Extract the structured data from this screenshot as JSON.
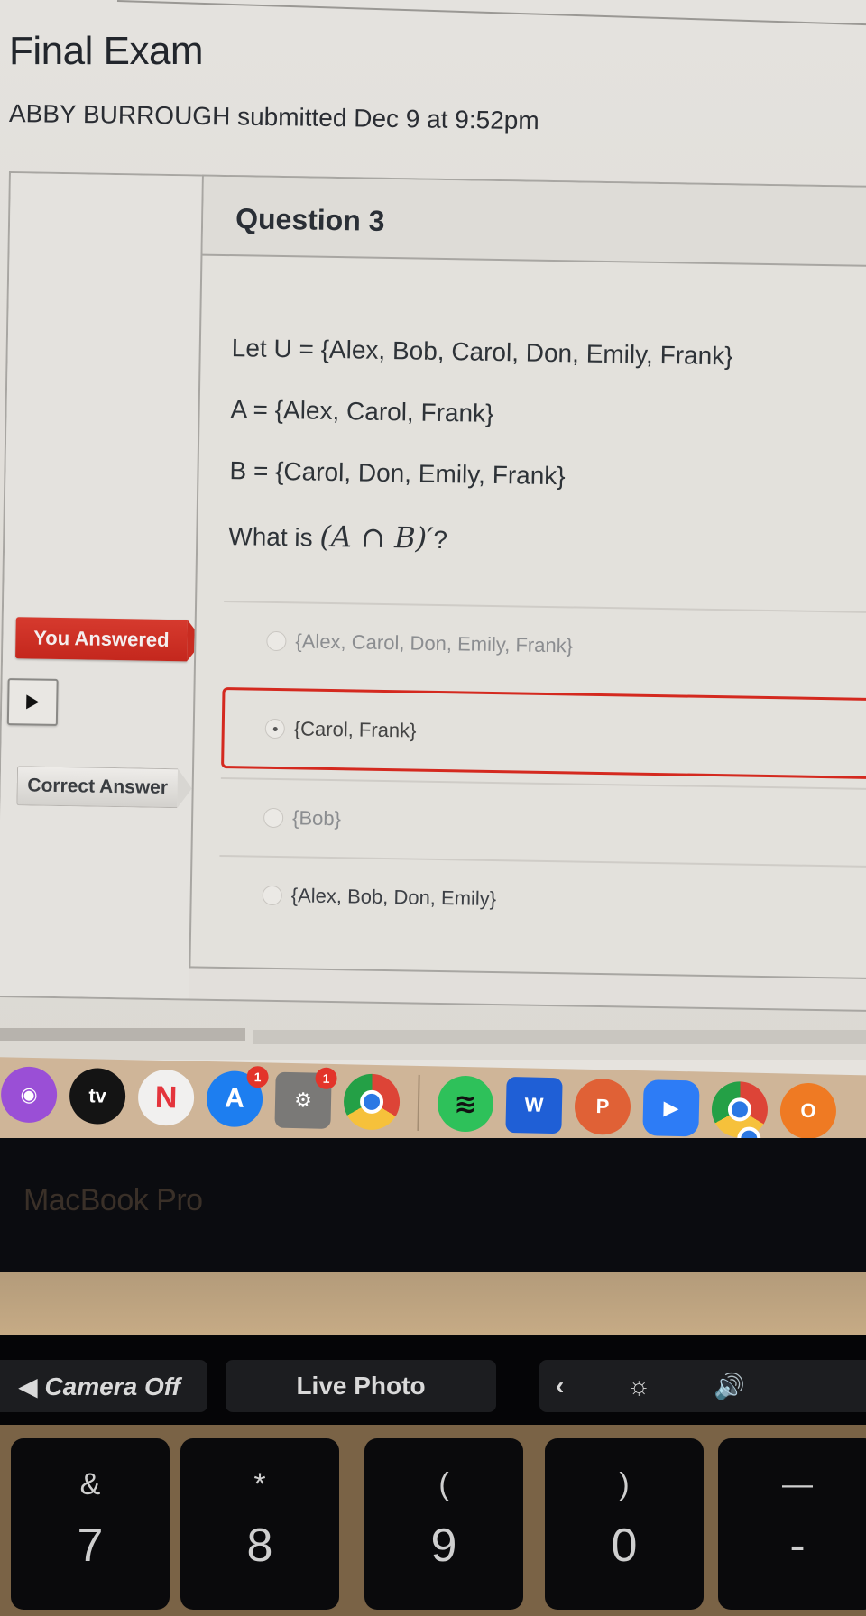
{
  "page": {
    "title": "Final Exam",
    "submitted": "ABBY BURROUGH submitted Dec 9 at 9:52pm"
  },
  "question": {
    "header": "Question 3",
    "lines": [
      "Let U = {Alex, Bob, Carol, Don, Emily, Frank}",
      "A = {Alex, Carol, Frank}",
      "B = {Carol, Don, Emily, Frank}"
    ],
    "prompt_prefix": "What is ",
    "prompt_math": "(A ∩ B)′",
    "prompt_suffix": "?",
    "answers": [
      {
        "label": "{Alex, Carol, Don, Emily, Frank}",
        "selected": false,
        "correct": false
      },
      {
        "label": "{Carol, Frank}",
        "selected": true,
        "correct": false
      },
      {
        "label": "{Bob}",
        "selected": false,
        "correct": false
      },
      {
        "label": "{Alex, Bob, Don, Emily}",
        "selected": false,
        "correct": true
      }
    ],
    "you_answered_label": "You Answered",
    "correct_answer_label": "Correct Answer"
  },
  "dock": {
    "apps": [
      {
        "name": "Podcasts",
        "glyph": "◉"
      },
      {
        "name": "Apple TV",
        "glyph": "tv"
      },
      {
        "name": "News",
        "glyph": "N"
      },
      {
        "name": "App Store",
        "glyph": "A",
        "badge": "1"
      },
      {
        "name": "System Preferences",
        "glyph": "⚙",
        "badge": "1"
      },
      {
        "name": "Chrome",
        "glyph": ""
      },
      {
        "name": "Spotify",
        "glyph": "≋"
      },
      {
        "name": "Word",
        "glyph": "W"
      },
      {
        "name": "PowerPoint",
        "glyph": "P"
      },
      {
        "name": "Zoom",
        "glyph": "▶"
      },
      {
        "name": "Chrome",
        "glyph": ""
      },
      {
        "name": "Origin",
        "glyph": "O"
      }
    ]
  },
  "bezel": {
    "label": "MacBook Pro"
  },
  "touchbar": {
    "camera": "◀ Camera Off",
    "live_photo": "Live Photo",
    "collapse": "‹",
    "brightness": "☼",
    "volume": "🔊"
  },
  "keys": [
    {
      "sym": "&",
      "num": "7"
    },
    {
      "sym": "*",
      "num": "8"
    },
    {
      "sym": "(",
      "num": "9"
    },
    {
      "sym": ")",
      "num": "0"
    },
    {
      "sym": "—",
      "num": "-"
    }
  ]
}
